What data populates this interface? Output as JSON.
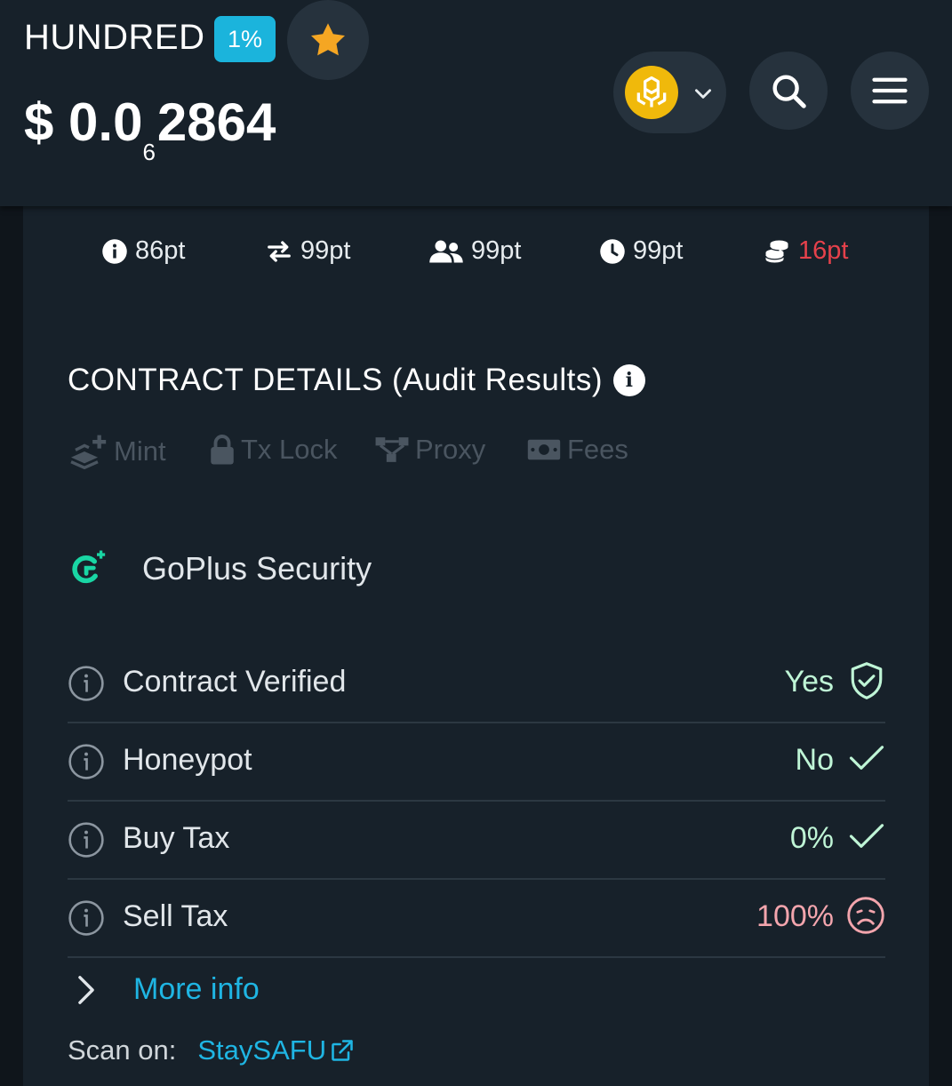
{
  "header": {
    "token_name": "HUNDRED",
    "change_badge": "1%",
    "price_prefix": "$ 0.0",
    "price_zero_count": "6",
    "price_digits": "2864",
    "star_icon": "star-icon",
    "chain_icon": "bnb-chain-icon",
    "search_icon": "search-icon",
    "menu_icon": "hamburger-menu-icon"
  },
  "scores": [
    {
      "icon": "info-icon",
      "value": "86pt"
    },
    {
      "icon": "transfer-icon",
      "value": "99pt"
    },
    {
      "icon": "users-icon",
      "value": "99pt"
    },
    {
      "icon": "clock-icon",
      "value": "99pt"
    },
    {
      "icon": "coins-icon",
      "value": "16pt",
      "color": "#e5414b"
    }
  ],
  "contract": {
    "title": "CONTRACT DETAILS (Audit Results)",
    "features": [
      "Mint",
      "Tx Lock",
      "Proxy",
      "Fees"
    ],
    "provider": "GoPlus Security",
    "checks": [
      {
        "label": "Contract Verified",
        "value": "Yes",
        "status_icon": "shield-check-icon"
      },
      {
        "label": "Honeypot",
        "value": "No",
        "status_icon": "check-icon"
      },
      {
        "label": "Buy Tax",
        "value": "0%",
        "status_icon": "check-icon"
      },
      {
        "label": "Sell Tax",
        "value": "100%",
        "status_icon": "sad-face-icon"
      }
    ],
    "more_info": "More info",
    "scan_label": "Scan on:",
    "scan_link": "StaySAFU"
  },
  "colors": {
    "accent": "#1bb4dc",
    "link": "#1fb5e3",
    "good": "#bff5d6",
    "bad": "#f3a5ad",
    "danger": "#e5414b",
    "star": "#f5a623",
    "bnb": "#f0b90b"
  }
}
